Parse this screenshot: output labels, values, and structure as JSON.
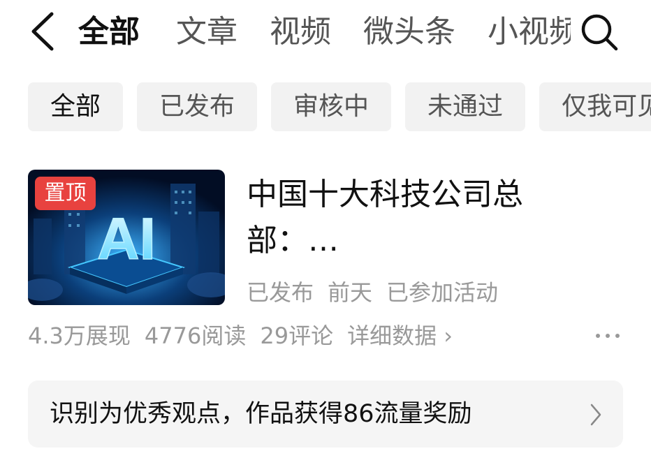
{
  "header": {
    "tabs": [
      {
        "label": "全部",
        "active": true
      },
      {
        "label": "文章",
        "active": false
      },
      {
        "label": "视频",
        "active": false
      },
      {
        "label": "微头条",
        "active": false
      },
      {
        "label": "小视频",
        "active": false
      }
    ],
    "back_icon": "chevron-left-icon",
    "search_icon": "search-icon"
  },
  "filters": [
    {
      "label": "全部",
      "active": true
    },
    {
      "label": "已发布",
      "active": false
    },
    {
      "label": "审核中",
      "active": false
    },
    {
      "label": "未通过",
      "active": false
    },
    {
      "label": "仅我可见",
      "active": false
    }
  ],
  "article": {
    "thumbnail_text": "AI",
    "pin_label": "置顶",
    "title": "中国十大科技公司总部：…",
    "status": "已发布",
    "time": "前天",
    "activity": "已参加活动",
    "impressions": "4.3万展现",
    "reads": "4776阅读",
    "comments": "29评论",
    "details": "详细数据 ›",
    "more_icon": "more-dots-icon"
  },
  "banner": {
    "text": "识别为优秀观点，作品获得86流量奖励",
    "chevron_icon": "chevron-right-icon"
  },
  "colors": {
    "pin_bg": "#e8423f",
    "chip_bg": "#f2f2f2",
    "banner_bg": "#f5f5f5",
    "muted_text": "#999999"
  }
}
